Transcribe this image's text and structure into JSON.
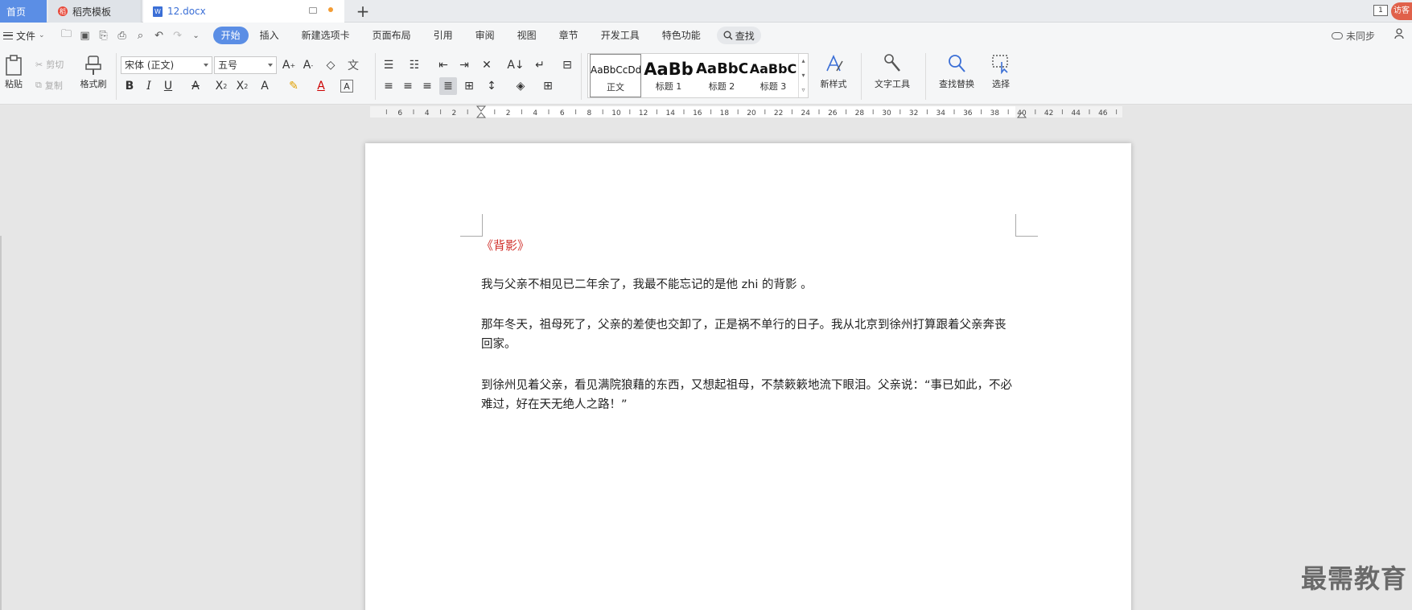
{
  "tabs": {
    "home": "首页",
    "template": "稻壳模板",
    "document": "12.docx",
    "page_badge": "1",
    "visitor": "访客"
  },
  "menu": {
    "file": "文件",
    "items": [
      "开始",
      "插入",
      "新建选项卡",
      "页面布局",
      "引用",
      "审阅",
      "视图",
      "章节",
      "开发工具",
      "特色功能"
    ],
    "search": "查找",
    "sync": "未同步"
  },
  "ribbon": {
    "paste": "粘贴",
    "cut": "剪切",
    "copy": "复制",
    "format_painter": "格式刷",
    "font_name": "宋体 (正文)",
    "font_size": "五号",
    "styles": [
      {
        "sample": "AaBbCcDd",
        "label": "正文"
      },
      {
        "sample": "AaBb",
        "label": "标题 1"
      },
      {
        "sample": "AaBbC",
        "label": "标题 2"
      },
      {
        "sample": "AaBbC",
        "label": "标题 3"
      }
    ],
    "new_style": "新样式",
    "text_tools": "文字工具",
    "find_replace": "查找替换",
    "select": "选择"
  },
  "ruler": {
    "labels": [
      "6",
      "4",
      "2",
      "2",
      "4",
      "6",
      "8",
      "10",
      "12",
      "14",
      "16",
      "18",
      "20",
      "22",
      "24",
      "26",
      "28",
      "30",
      "32",
      "34",
      "36",
      "38",
      "40",
      "42",
      "44",
      "46"
    ]
  },
  "document": {
    "title": "《背影》",
    "paragraphs": [
      "我与父亲不相见已二年余了，我最不能忘记的是他 zhi 的背影 。",
      "那年冬天，祖母死了，父亲的差使也交卸了，正是祸不单行的日子。我从北京到徐州打算跟着父亲奔丧回家。",
      "到徐州见着父亲，看见满院狼藉的东西，又想起祖母，不禁簌簌地流下眼泪。父亲说：“事已如此，不必难过，好在天无绝人之路！”"
    ]
  },
  "watermark": "最需教育",
  "colors": {
    "accent": "#5b8ee5",
    "title_red": "#d0312d"
  }
}
